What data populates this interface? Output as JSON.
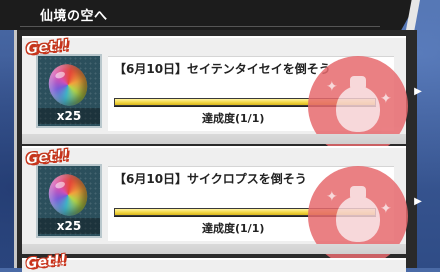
{
  "header": {
    "title": "仙境の空へ"
  },
  "missions": [
    {
      "badge": "Get!!",
      "reward_quantity": "x25",
      "reward_icon": "rainbow-orb-icon",
      "title": "【6月10日】セイテンタイセイを倒そう",
      "progress_label": "達成度(1/1)",
      "progress_fraction": 1.0,
      "stamp_icon": "money-bag-stamp-icon"
    },
    {
      "badge": "Get!!",
      "reward_quantity": "x25",
      "reward_icon": "rainbow-orb-icon",
      "title": "【6月10日】サイクロプスを倒そう",
      "progress_label": "達成度(1/1)",
      "progress_fraction": 1.0,
      "stamp_icon": "money-bag-stamp-icon"
    }
  ],
  "partial_badge": "Get!!",
  "colors": {
    "header_bg": "#1c1c1c",
    "get_red": "#c9331b",
    "stamp_red": "#e76a6e",
    "progress_yellow": "#f2d640"
  }
}
